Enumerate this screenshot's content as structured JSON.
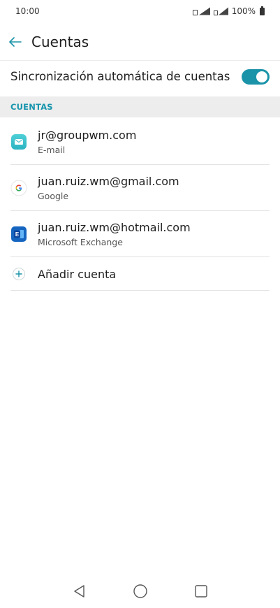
{
  "status": {
    "time": "10:00",
    "battery": "100%"
  },
  "appbar": {
    "title": "Cuentas"
  },
  "sync": {
    "label": "Sincronización automática de cuentas",
    "enabled": true
  },
  "section": {
    "header": "CUENTAS"
  },
  "accounts": [
    {
      "title": "jr@groupwm.com",
      "subtitle": "E-mail",
      "icon": "email-app-icon"
    },
    {
      "title": "juan.ruiz.wm@gmail.com",
      "subtitle": "Google",
      "icon": "google-icon"
    },
    {
      "title": "juan.ruiz.wm@hotmail.com",
      "subtitle": "Microsoft Exchange",
      "icon": "exchange-icon"
    }
  ],
  "add_account": {
    "label": "Añadir cuenta"
  },
  "colors": {
    "accent": "#1a93a8",
    "section_bg": "#ededed"
  }
}
